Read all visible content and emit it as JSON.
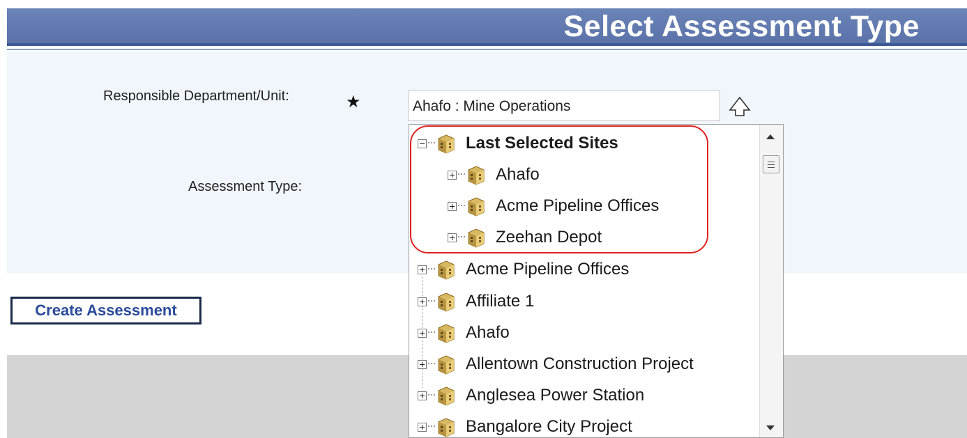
{
  "header": {
    "title": "Select Assessment Type"
  },
  "form": {
    "dept_label": "Responsible Department/Unit:",
    "required_mark": "★",
    "dept_value": "Ahafo : Mine Operations",
    "assessment_type_label": "Assessment Type:"
  },
  "actions": {
    "create_label": "Create Assessment"
  },
  "tree": {
    "group": {
      "label": "Last Selected Sites",
      "children": [
        "Ahafo",
        "Acme Pipeline Offices",
        "Zeehan Depot"
      ]
    },
    "sites": [
      "Acme Pipeline Offices",
      "Affiliate 1",
      "Ahafo",
      "Allentown Construction Project",
      "Anglesea Power Station",
      "Bangalore City Project"
    ]
  },
  "colors": {
    "header": "#5a72a8",
    "highlight": "#e02020",
    "panel": "#f0f6fc",
    "link": "#2a4a9a"
  },
  "icons": {
    "site": "building-icon",
    "expand": "expand-plus-icon",
    "collapse": "collapse-minus-icon"
  }
}
